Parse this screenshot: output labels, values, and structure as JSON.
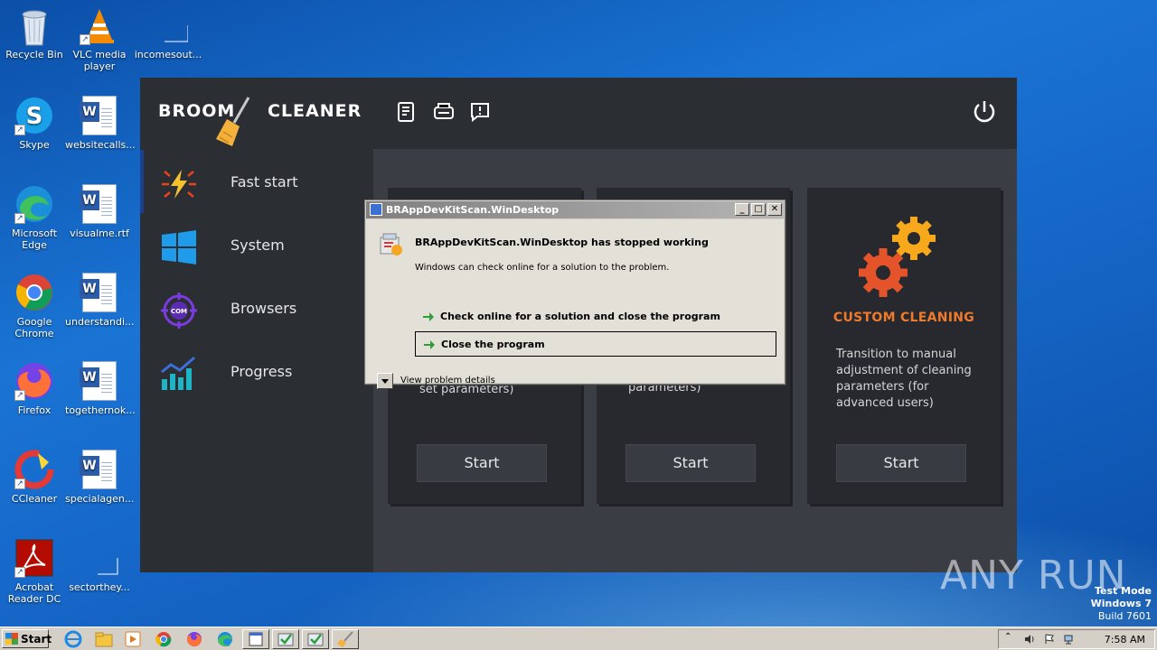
{
  "desktop": {
    "icons": [
      {
        "label": "Recycle Bin"
      },
      {
        "label": "VLC media player"
      },
      {
        "label": "incomesout..."
      },
      {
        "label": "Skype"
      },
      {
        "label": "websitecalls..."
      },
      {
        "label": "Microsoft Edge"
      },
      {
        "label": "visualme.rtf"
      },
      {
        "label": "Google Chrome"
      },
      {
        "label": "understandi..."
      },
      {
        "label": "Firefox"
      },
      {
        "label": "togethernok..."
      },
      {
        "label": "CCleaner"
      },
      {
        "label": "specialagen..."
      },
      {
        "label": "Acrobat Reader DC"
      },
      {
        "label": "sectorthey..."
      }
    ]
  },
  "app": {
    "logo_left": "BROOM",
    "logo_right": "CLEANER",
    "nav": [
      {
        "label": "Fast start",
        "icon": "lightning-icon"
      },
      {
        "label": "System",
        "icon": "windows-icon"
      },
      {
        "label": "Browsers",
        "icon": "browser-target-icon"
      },
      {
        "label": "Progress",
        "icon": "bar-chart-icon"
      }
    ],
    "toolbar": {
      "icons": [
        "document-icon",
        "scanner-icon",
        "feedback-icon"
      ],
      "power_icon": "power-icon"
    },
    "cards": [
      {
        "title": "",
        "desc_fragment": "set parameters)",
        "button": "Start"
      },
      {
        "title": "",
        "desc_fragment": "parameters)",
        "button": "Start"
      },
      {
        "title": "CUSTOM CLEANING",
        "desc": "Transition to manual adjustment of cleaning parameters (for advanced users)",
        "button": "Start"
      }
    ],
    "accent_color": "#f07a2c"
  },
  "dialog": {
    "title": "BRAppDevKitScan.WinDesktop",
    "heading": "BRAppDevKitScan.WinDesktop has stopped working",
    "subtext": "Windows can check online for a solution to the problem.",
    "options": [
      "Check online for a solution and close the program",
      "Close the program"
    ],
    "details": "View problem details"
  },
  "watermark": "ANY RUN",
  "test_mode": {
    "line1": "Test Mode",
    "line2": "Windows 7",
    "line3": "Build 7601"
  },
  "taskbar": {
    "start_label": "Start",
    "clock": "7:58 AM"
  }
}
